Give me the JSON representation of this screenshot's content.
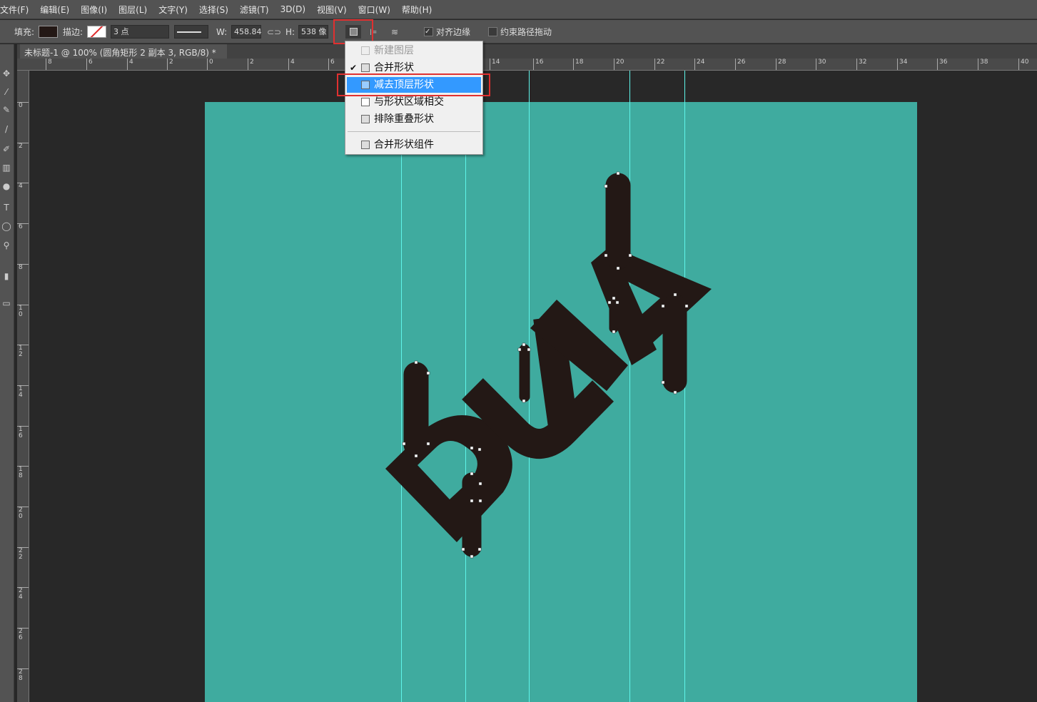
{
  "menubar": [
    "文件(F)",
    "编辑(E)",
    "图像(I)",
    "图层(L)",
    "文字(Y)",
    "选择(S)",
    "滤镜(T)",
    "3D(D)",
    "视图(V)",
    "窗口(W)",
    "帮助(H)"
  ],
  "options": {
    "fill_label": "填充:",
    "fill_color": "#231815",
    "stroke_label": "描边:",
    "stroke_size": "3 点",
    "w_label": "W:",
    "w_value": "458.84",
    "h_label": "H:",
    "h_value": "538 像",
    "align_edges": "对齐边缘",
    "align_checked": true,
    "constrain": "约束路径拖动",
    "constrain_checked": false
  },
  "document_tab": {
    "title": "未标题-1 @ 100% (圆角矩形 2 副本 3, RGB/8) *",
    "close": "×"
  },
  "ruler_top": [
    "8",
    "6",
    "4",
    "2",
    "0",
    "2",
    "4",
    "6",
    "14",
    "16",
    "18",
    "20",
    "22",
    "24",
    "26",
    "28",
    "30",
    "32",
    "34",
    "36",
    "38",
    "40"
  ],
  "ruler_left": [
    "0",
    "2",
    "4",
    "6",
    "8",
    "10",
    "12",
    "14",
    "16",
    "18",
    "20",
    "22",
    "24",
    "26",
    "28"
  ],
  "path_ops_menu": {
    "items": [
      {
        "label": "新建图层",
        "disabled": true,
        "checked": false
      },
      {
        "label": "合并形状",
        "checked": true
      },
      {
        "label": "减去顶层形状",
        "highlighted": true
      },
      {
        "label": "与形状区域相交"
      },
      {
        "label": "排除重叠形状"
      },
      {
        "label": "合并形状组件"
      }
    ]
  },
  "colors": {
    "canvas": "#3fab9f",
    "shape": "#231815",
    "highlight": "#3399ff",
    "guide": "#5ff5ea"
  }
}
